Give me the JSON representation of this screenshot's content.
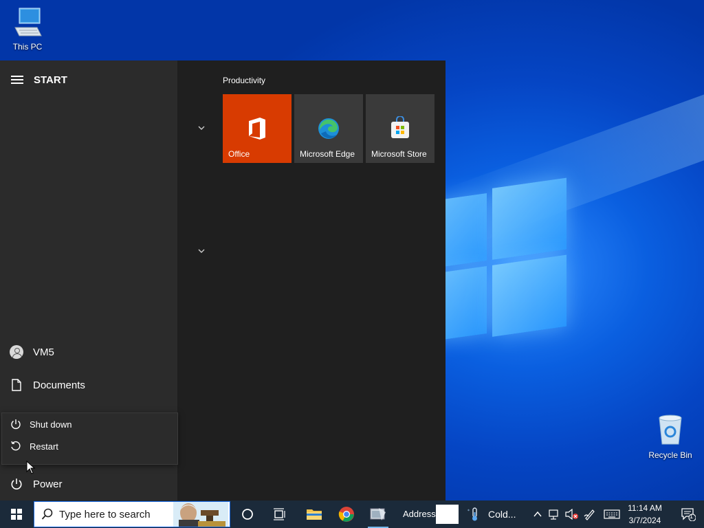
{
  "desktop": {
    "this_pc_label": "This PC",
    "recycle_bin_label": "Recycle Bin"
  },
  "start_menu": {
    "title": "START",
    "user_name": "VM5",
    "documents_label": "Documents",
    "power_label": "Power",
    "power_menu": [
      {
        "label": "Shut down"
      },
      {
        "label": "Restart"
      }
    ],
    "group_label": "Productivity",
    "tiles": [
      {
        "label": "Office",
        "color": "#D83B01"
      },
      {
        "label": "Microsoft Edge",
        "color": "#3a3a3a"
      },
      {
        "label": "Microsoft Store",
        "color": "#3a3a3a"
      }
    ]
  },
  "taskbar": {
    "search_placeholder": "Type here to search",
    "address_label": "Address",
    "weather_text": "Cold...",
    "time": "11:14 AM",
    "date": "3/7/2024",
    "notification_count": "1",
    "background": "#1b2a3a"
  }
}
